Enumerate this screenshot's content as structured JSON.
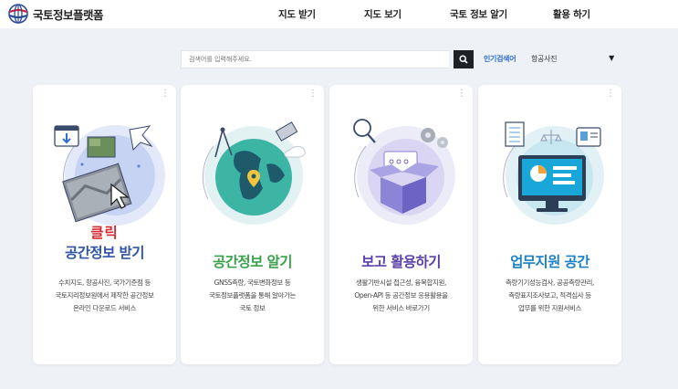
{
  "header": {
    "logo_text": "국토정보플랫폼",
    "nav": [
      {
        "label": "지도 받기"
      },
      {
        "label": "지도 보기"
      },
      {
        "label": "국토 정보 알기"
      },
      {
        "label": "활용 하기"
      }
    ]
  },
  "search": {
    "placeholder": "검색어를 입력해주세요.",
    "button_icon": "search-icon",
    "popular_label": "인기검색어",
    "popular_selected": "항공사진"
  },
  "cards": [
    {
      "click_label": "클릭",
      "title": "공간정보 받기",
      "title_color": "#2f54a8",
      "desc": [
        "수치지도, 항공사진, 국가기준점 등",
        "국토지리정보원에서 제작한 공간정보",
        "온라인 다운로드 서비스"
      ],
      "illustration": "map-download-illustration"
    },
    {
      "title": "공간정보 알기",
      "title_color": "#3aa14a",
      "desc": [
        "GNSS측량, 국토변화정보 등",
        "국토정보플랫폼을 통해 알아가는",
        "국토 정보"
      ],
      "illustration": "globe-illustration"
    },
    {
      "title": "보고 활용하기",
      "title_color": "#5b3fa8",
      "desc": [
        "생활기반시설 접근성, 융복합지원,",
        "Open-API 등 공간정보 응용활용을",
        "위한 서비스 바로가기"
      ],
      "illustration": "box-illustration"
    },
    {
      "title": "업무지원 공간",
      "title_color": "#1c80c7",
      "desc": [
        "측량기기성능검사, 공공측량관리,",
        "측량표지조사보고, 적격심사 등",
        "업무를 위한 지원서비스"
      ],
      "illustration": "monitor-illustration"
    }
  ],
  "colors": {
    "background": "#eef1f5",
    "accent_blue": "#2e6fd6",
    "click_red": "#d7282f"
  }
}
